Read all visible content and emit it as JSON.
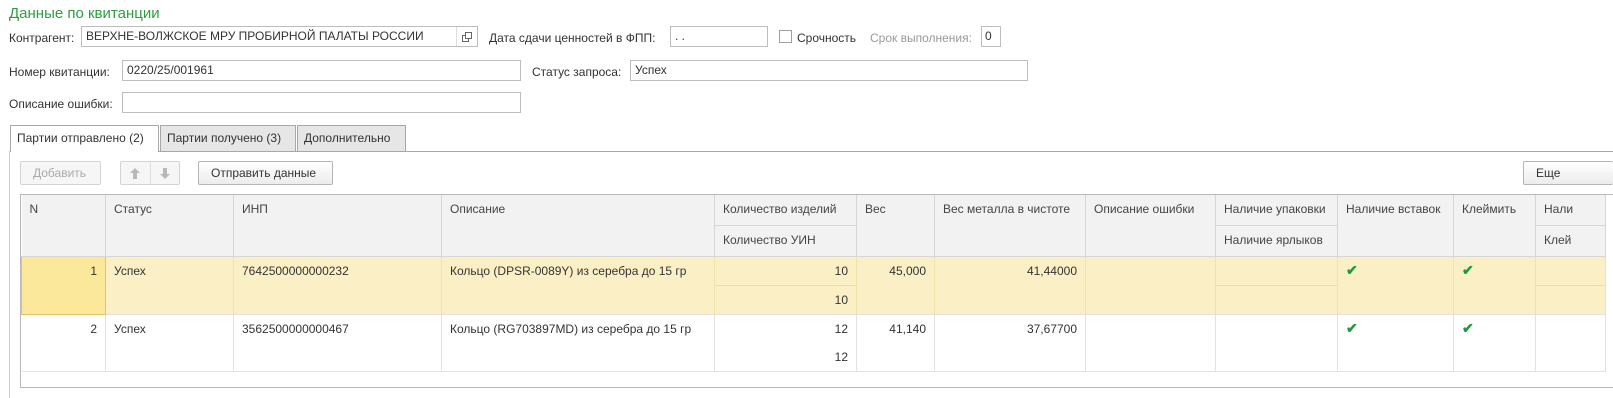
{
  "form": {
    "title": "Данные по квитанции",
    "counterparty_label": "Контрагент:",
    "counterparty_value": "ВЕРХНЕ-ВОЛЖСКОЕ МРУ ПРОБИРНОЙ ПАЛАТЫ РОССИИ",
    "delivery_date_label": "Дата сдачи ценностей в ФПП:",
    "delivery_date_value": " .  .",
    "urgency_label": "Срочность",
    "deadline_label": "Срок выполнения:",
    "deadline_value": "0",
    "receipt_number_label": "Номер квитанции:",
    "receipt_number_value": "0220/25/001961",
    "request_status_label": "Статус запроса:",
    "request_status_value": "Успех",
    "error_description_label": "Описание ошибки:",
    "error_description_value": ""
  },
  "tabs": [
    {
      "label": "Партии отправлено (2)"
    },
    {
      "label": "Партии получено (3)"
    },
    {
      "label": "Дополнительно"
    }
  ],
  "toolbar": {
    "add_label": "Добавить",
    "send_label": "Отправить данные",
    "more_label": "Еще"
  },
  "grid": {
    "headers": {
      "n": "N",
      "status": "Статус",
      "inp": "ИНП",
      "description": "Описание",
      "items_count": "Количество изделий",
      "uin_count": "Количество УИН",
      "weight": "Вес",
      "pure_weight": "Вес металла в чистоте",
      "error_description": "Описание ошибки",
      "packaging": "Наличие упаковки",
      "labels": "Наличие ярлыков",
      "inserts": "Наличие вставок",
      "stamp": "Клеймить",
      "extra_top": "Нали",
      "extra_bottom": "Клей"
    },
    "rows": [
      {
        "n": "1",
        "status": "Успех",
        "inp": "7642500000000232",
        "description": "Кольцо (DPSR-0089Y) из серебра до 15 гр",
        "items_count": "10",
        "uin_count": "10",
        "weight": "45,000",
        "pure_weight": "41,44000",
        "inserts": "✔",
        "stamp": "✔"
      },
      {
        "n": "2",
        "status": "Успех",
        "inp": "3562500000000467",
        "description": "Кольцо (RG703897MD) из серебра до 15 гр",
        "items_count": "12",
        "uin_count": "12",
        "weight": "41,140",
        "pure_weight": "37,67700",
        "inserts": "✔",
        "stamp": "✔"
      }
    ]
  },
  "colors": {
    "title_green": "#2e9e3e",
    "selected_row": "#fbf0c5",
    "check_green": "#1f9a3a"
  }
}
